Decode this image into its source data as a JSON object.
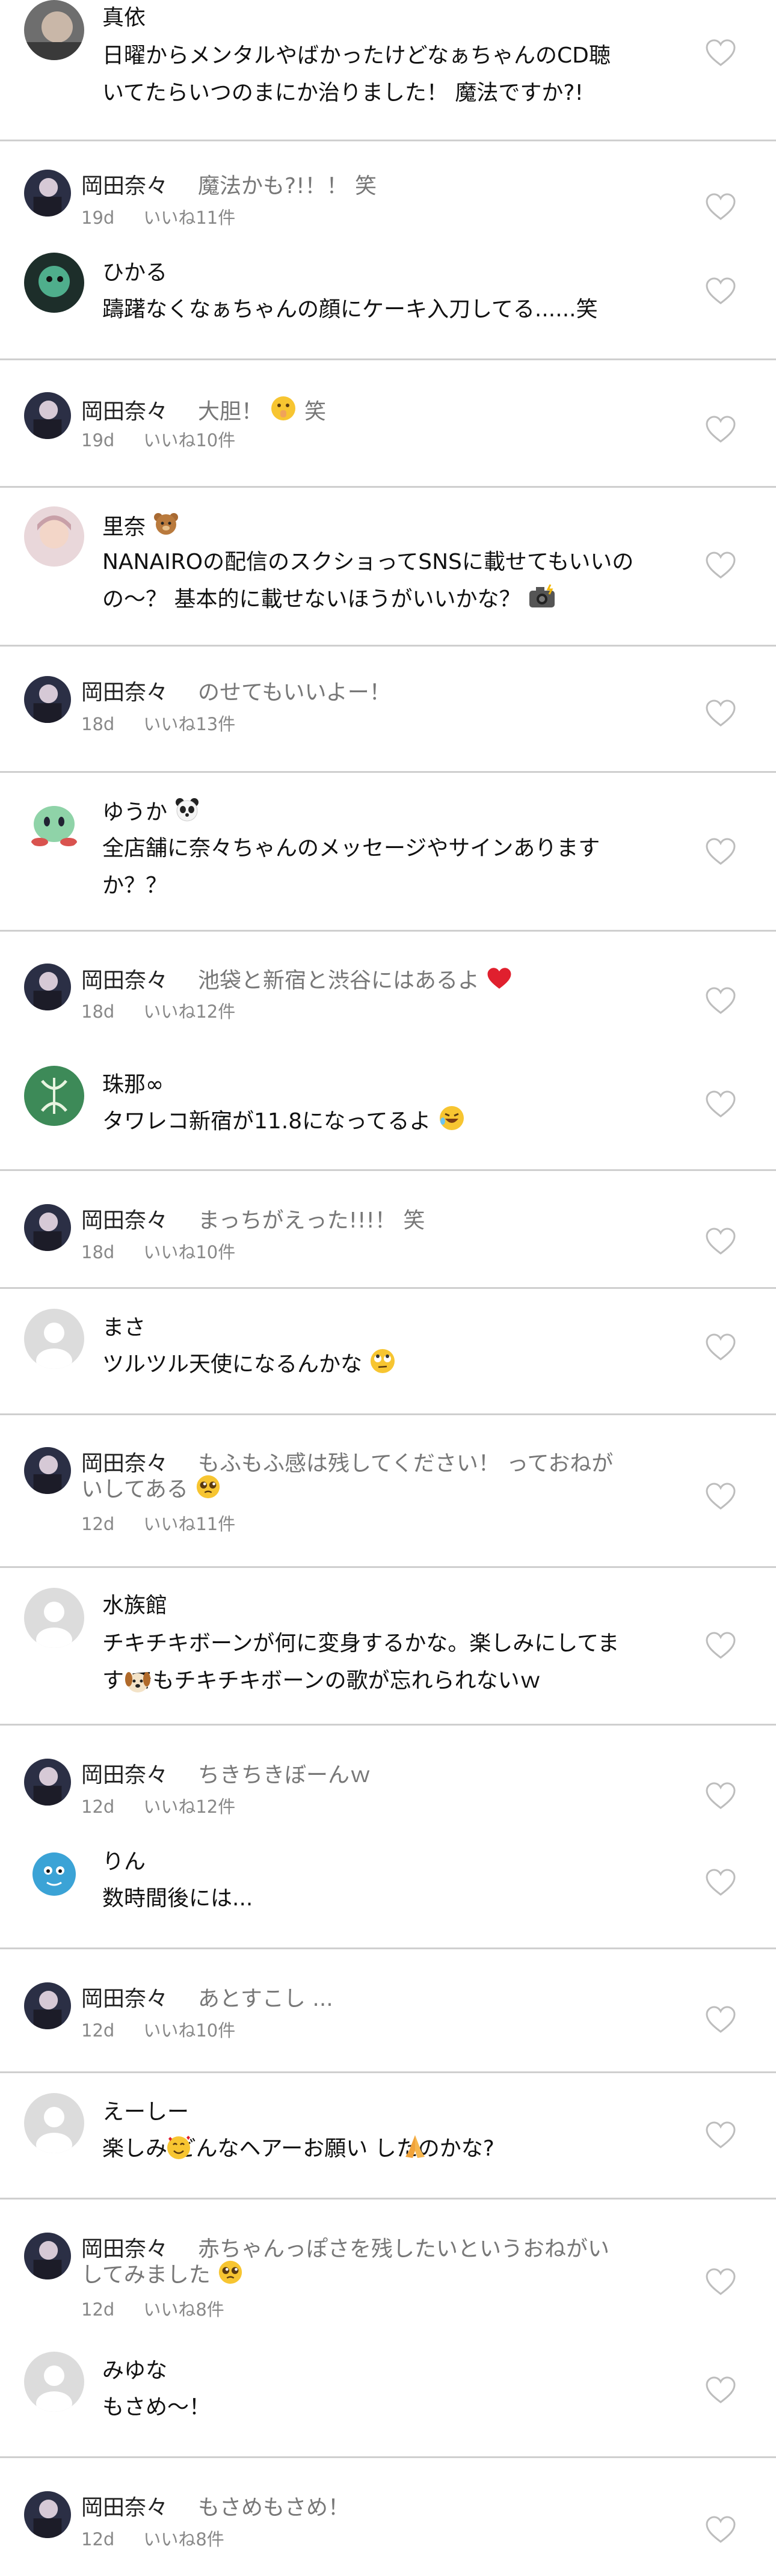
{
  "comments": [
    {
      "name": "真依",
      "lines": [
        "日曜からメンタルやばかったけどなぁちゃんのCD聴",
        "いてたらいつのまにか治りました！ 魔法ですか?!"
      ]
    },
    {
      "reply": true,
      "name": "岡田奈々",
      "text": "魔法かも?!！！ 笑",
      "age": "19d",
      "likes": "いいね11件"
    },
    {
      "name": "ひかる",
      "lines": [
        "躊躇なくなぁちゃんの顔にケーキ入刀してる......笑"
      ]
    },
    {
      "reply": true,
      "name": "岡田奈々",
      "text": "大胆！",
      "text_after": "笑",
      "age": "19d",
      "likes": "いいね10件"
    },
    {
      "name": "里奈",
      "lines": [
        "NANAIROの配信のスクショってSNSに載せてもいいの",
        "の〜？ 基本的に載せないほうがいいかな？"
      ]
    },
    {
      "reply": true,
      "name": "岡田奈々",
      "text": "のせてもいいよー！",
      "age": "18d",
      "likes": "いいね13件"
    },
    {
      "name": "ゆうか",
      "lines": [
        "全店舗に奈々ちゃんのメッセージやサインあります",
        "か？？"
      ]
    },
    {
      "reply": true,
      "name": "岡田奈々",
      "text": "池袋と新宿と渋谷にはあるよ",
      "age": "18d",
      "likes": "いいね12件"
    },
    {
      "name": "珠那∞",
      "lines": [
        "タワレコ新宿が11.8になってるよ"
      ]
    },
    {
      "reply": true,
      "name": "岡田奈々",
      "text": "まっちがえった!!!！ 笑",
      "age": "18d",
      "likes": "いいね10件"
    },
    {
      "name": "まさ",
      "lines": [
        "ツルツル天使になるんかな"
      ]
    },
    {
      "reply": true,
      "name": "岡田奈々",
      "text": "もふもふ感は残してください！ っておねが",
      "text2": "いしてある",
      "age": "12d",
      "likes": "いいね11件"
    },
    {
      "name": "水族館",
      "lines": [
        "チキチキボーンが何に変身するかな。楽しみにしてま",
        "す でもチキチキボーンの歌が忘れられないｗ"
      ]
    },
    {
      "reply": true,
      "name": "岡田奈々",
      "text": "ちきちきぼーんｗ",
      "age": "12d",
      "likes": "いいね12件"
    },
    {
      "name": "りん",
      "lines": [
        "数時間後には..."
      ]
    },
    {
      "reply": true,
      "name": "岡田奈々",
      "text": "あとすこし ...",
      "age": "12d",
      "likes": "いいね10件"
    },
    {
      "name": "えーしー",
      "lines": [
        "楽しみ どんなヘアーお願い したのかな?"
      ]
    },
    {
      "reply": true,
      "name": "岡田奈々",
      "text": "赤ちゃんっぽさを残したいというおねがい",
      "text2": "してみました",
      "age": "12d",
      "likes": "いいね8件"
    },
    {
      "name": "みゆな",
      "lines": [
        "もさめ〜！"
      ]
    },
    {
      "reply": true,
      "name": "岡田奈々",
      "text": "もさめもさめ！",
      "age": "12d",
      "likes": "いいね8件"
    }
  ],
  "colors": {
    "separator": "#cfcfcf",
    "secondary_text": "#777777",
    "heart_outline": "#bdbdbd"
  },
  "icons": {
    "like": "heart-outline-icon",
    "default_avatar": "person-silhouette-icon"
  }
}
